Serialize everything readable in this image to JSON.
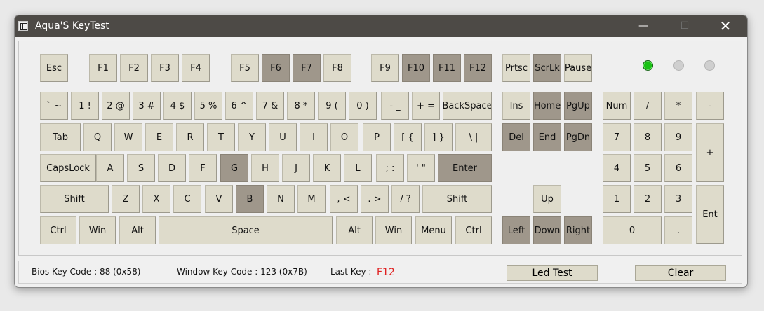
{
  "window": {
    "title": "Aqua'S KeyTest",
    "min_glyph": "—",
    "max_glyph": "☐",
    "close_glyph": "✕"
  },
  "keys": {
    "esc": "Esc",
    "f1": "F1",
    "f2": "F2",
    "f3": "F3",
    "f4": "F4",
    "f5": "F5",
    "f6": "F6",
    "f7": "F7",
    "f8": "F8",
    "f9": "F9",
    "f10": "F10",
    "f11": "F11",
    "f12": "F12",
    "prtsc": "Prtsc",
    "scrlk": "ScrLk",
    "pause": "Pause",
    "backtick": "` ~",
    "n1": "1 !",
    "n2": "2 @",
    "n3": "3 #",
    "n4": "4 $",
    "n5": "5 %",
    "n6": "6 ^",
    "n7": "7 &",
    "n8": "8 *",
    "n9": "9 (",
    "n0": "0 )",
    "minus": "- _",
    "equal": "+ =",
    "backspace": "BackSpace",
    "ins": "Ins",
    "home": "Home",
    "pgup": "PgUp",
    "numlock": "Num",
    "kp_div": "/",
    "kp_mul": "*",
    "kp_minus": "-",
    "tab": "Tab",
    "q": "Q",
    "w": "W",
    "e": "E",
    "r": "R",
    "t": "T",
    "y": "Y",
    "u": "U",
    "i": "I",
    "o": "O",
    "p": "P",
    "lbracket": "[ {",
    "rbracket": "] }",
    "backslash": "\\ |",
    "del": "Del",
    "end": "End",
    "pgdn": "PgDn",
    "kp7": "7",
    "kp8": "8",
    "kp9": "9",
    "kp_plus": "+",
    "capslock": "CapsLock",
    "a": "A",
    "s": "S",
    "d": "D",
    "f": "F",
    "g": "G",
    "h": "H",
    "j": "J",
    "k": "K",
    "l": "L",
    "semicolon": "; :",
    "quote": "' \"",
    "enter": "Enter",
    "kp4": "4",
    "kp5": "5",
    "kp6": "6",
    "lshift": "Shift",
    "z": "Z",
    "x": "X",
    "c": "C",
    "v": "V",
    "b": "B",
    "n": "N",
    "m": "M",
    "comma": ", <",
    "period": ". >",
    "slash": "/ ?",
    "rshift": "Shift",
    "up": "Up",
    "kp1": "1",
    "kp2": "2",
    "kp3": "3",
    "kp_enter": "Ent",
    "lctrl": "Ctrl",
    "lwin": "Win",
    "lalt": "Alt",
    "space": "Space",
    "ralt": "Alt",
    "rwin": "Win",
    "menu": "Menu",
    "rctrl": "Ctrl",
    "left": "Left",
    "down": "Down",
    "right": "Right",
    "kp0": "0",
    "kp_dot": "."
  },
  "pressed_keys": [
    "F6",
    "F7",
    "F10",
    "F11",
    "F12",
    "ScrLk",
    "Home",
    "PgUp",
    "Del",
    "End",
    "PgDn",
    "G",
    "B",
    "Enter",
    "Left",
    "Down",
    "Right"
  ],
  "leds": {
    "num_lock": "on",
    "caps_lock": "off",
    "scroll_lock": "off",
    "on_color": "#19c114"
  },
  "status": {
    "bios_key_code": "Bios Key Code : 88 (0x58)",
    "window_key_code": "Window Key Code : 123 (0x7B)",
    "last_key_label": "Last Key :",
    "last_key_value": "F12",
    "last_key_color": "#e02020",
    "led_test_label": "Led Test",
    "clear_label": "Clear"
  },
  "colors": {
    "key_idle": "#dedbcb",
    "key_pressed": "#9f978b",
    "titlebar": "#4d4a46"
  }
}
